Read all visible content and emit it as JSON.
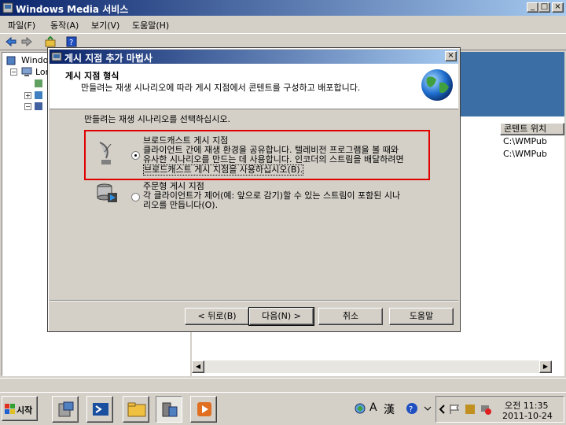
{
  "main_window": {
    "title": "Windows Media 서비스",
    "menu": [
      "파일(F)",
      "동작(A)",
      "보기(V)",
      "도움말(H)"
    ],
    "tree": {
      "root": "Windows",
      "local": "Lor"
    },
    "right_pane": {
      "col_header": "콘텐트 위치",
      "rows": [
        "C:\\WMPub",
        "C:\\WMPub"
      ]
    }
  },
  "wizard": {
    "title": "게시 지점 추가 마법사",
    "header_title": "게시 지점 형식",
    "header_subtitle": "만들려는 재생 시나리오에 따라 게시 지점에서 콘텐트를 구성하고 배포합니다.",
    "prompt": "만들려는 재생 시나리오를 선택하십시오.",
    "options": [
      {
        "title": "브로드캐스트 게시 지점",
        "lines": [
          "클라이언트 간에 재생 환경을 공유합니다. 텔레비전 프로그램을 볼 때와",
          "유사한 시나리오를 만드는 데 사용합니다. 인코더의 스트림을 배달하려면",
          "브로드캐스트 게시 지점을 사용하십시오(B)."
        ],
        "selected": true
      },
      {
        "title": "주문형 게시 지점",
        "lines": [
          "각 클라이언트가 제어(예: 앞으로 감기)할 수 있는 스트림이 포함된 시나",
          "리오를 만듭니다(O)."
        ],
        "selected": false
      }
    ],
    "buttons": {
      "back": "< 뒤로(B)",
      "next": "다음(N) >",
      "cancel": "취소",
      "help": "도움말"
    }
  },
  "taskbar": {
    "start": "시작",
    "ime_label": "A",
    "han_label": "漢",
    "clock_time": "오전 11:35",
    "clock_date": "2011-10-24"
  },
  "colors": {
    "titlebar": "#0a246a",
    "highlight": "#e00000",
    "face": "#d4d0c8"
  }
}
